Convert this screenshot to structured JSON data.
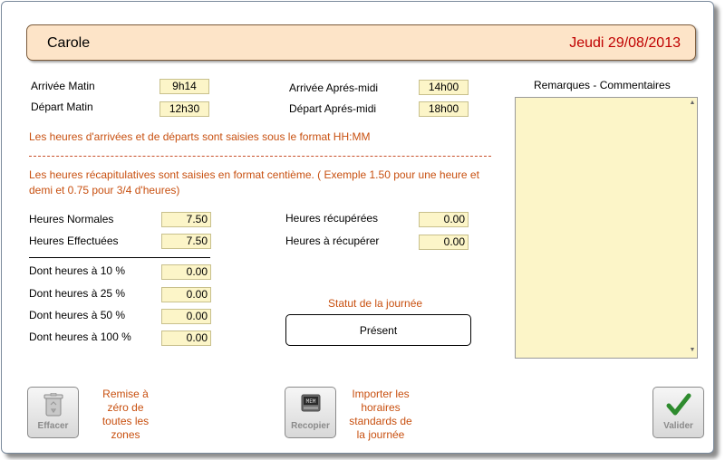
{
  "header": {
    "name": "Carole",
    "date": "Jeudi 29/08/2013"
  },
  "times": {
    "arrivee_matin_label": "Arrivée Matin",
    "arrivee_matin_value": "9h14",
    "depart_matin_label": "Départ Matin",
    "depart_matin_value": "12h30",
    "arrivee_am_label": "Arrivée Aprés-midi",
    "arrivee_am_value": "14h00",
    "depart_am_label": "Départ Aprés-midi",
    "depart_am_value": "18h00"
  },
  "notes": {
    "format_hhmm": "Les heures d'arrivées et de départs sont saisies sous le format HH:MM",
    "format_centieme": "Les heures récapitulatives sont saisies en format centième. ( Exemple 1.50 pour une heure et demi et 0.75 pour 3/4 d'heures)"
  },
  "hours": {
    "normales_label": "Heures Normales",
    "normales_value": "7.50",
    "effectuees_label": "Heures Effectuées",
    "effectuees_value": "7.50",
    "recuperees_label": "Heures récupérées",
    "recuperees_value": "0.00",
    "a_recuperer_label": "Heures à récupérer",
    "a_recuperer_value": "0.00"
  },
  "overtime": [
    {
      "label": "Dont heures à 10 %",
      "value": "0.00"
    },
    {
      "label": "Dont heures à 25 %",
      "value": "0.00"
    },
    {
      "label": "Dont heures à 50 %",
      "value": "0.00"
    },
    {
      "label": "Dont heures à 100 %",
      "value": "0.00"
    }
  ],
  "remarks": {
    "title": "Remarques - Commentaires",
    "value": ""
  },
  "statut": {
    "title": "Statut de la journée",
    "value": "Présent"
  },
  "buttons": {
    "effacer_label": "Effacer",
    "effacer_note": "Remise à zéro de toutes les zones",
    "recopier_label": "Recopier",
    "recopier_note": "Importer les horaires standards de la journée",
    "valider_label": "Valider"
  },
  "colors": {
    "accent": "#c85010",
    "header_bg": "#fde4c8",
    "field_bg": "#fcf5c8",
    "date": "#c00000"
  },
  "icons": {
    "effacer": "trash-icon",
    "recopier": "memory-icon",
    "valider": "checkmark-icon"
  }
}
